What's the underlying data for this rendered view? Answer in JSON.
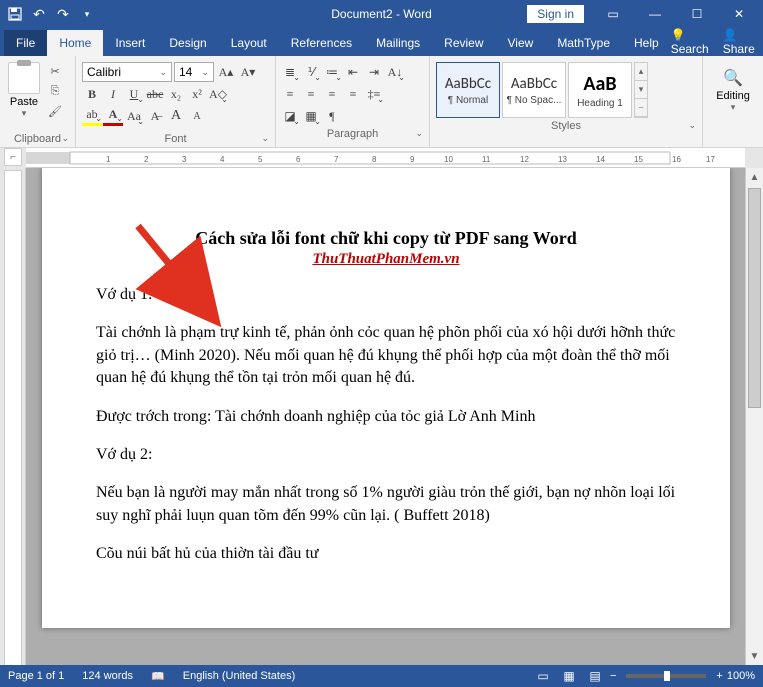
{
  "title": "Document2 - Word",
  "signin": "Sign in",
  "tabs": {
    "file": "File",
    "home": "Home",
    "insert": "Insert",
    "design": "Design",
    "layout": "Layout",
    "references": "References",
    "mailings": "Mailings",
    "review": "Review",
    "view": "View",
    "mathtype": "MathType",
    "help": "Help"
  },
  "tell_me": "Search",
  "share": "Share",
  "font": {
    "name": "Calibri",
    "size": "14"
  },
  "groups": {
    "clipboard": "Clipboard",
    "font": "Font",
    "paragraph": "Paragraph",
    "styles": "Styles",
    "editing": "Editing"
  },
  "paste": "Paste",
  "styles": [
    {
      "preview": "AaBbCc",
      "name": "¶ Normal"
    },
    {
      "preview": "AaBbCc",
      "name": "¶ No Spac..."
    },
    {
      "preview": "AaB",
      "name": "Heading 1"
    }
  ],
  "editing": "Editing",
  "doc": {
    "title": "Cách sửa lỗi font chữ khi copy từ PDF sang Word",
    "sub": "ThuThuatPhanMem.vn",
    "p1": "Vớ dụ 1:",
    "p2": "Tài chớnh là phạm trự kinh tế, phản ỏnh cỏc quan hệ phõn phối của xó hội dưới hỡnh thức giỏ trị… (Minh 2020). Nếu mối quan hệ đú khụng thể phối hợp của một đoàn thể thỡ mối quan hệ đú khụng thể tồn tại trỏn mối quan hệ đú.",
    "p3": "Được trớch trong: Tài chớnh doanh nghiệp của tỏc giả Lờ Anh Minh",
    "p4": "Vớ dụ 2:",
    "p5": "Nếu bạn là người may mắn nhất trong số 1% người giàu trỏn thế giới, bạn nợ nhõn loại lối suy nghĩ phải luụn quan tõm đến 99% cũn lại. ( Buffett 2018)",
    "p6": "Cõu núi bất hủ của thiờn tài đầu tư"
  },
  "status": {
    "page": "Page 1 of 1",
    "words": "124 words",
    "lang": "English (United States)",
    "zoom": "100%"
  }
}
